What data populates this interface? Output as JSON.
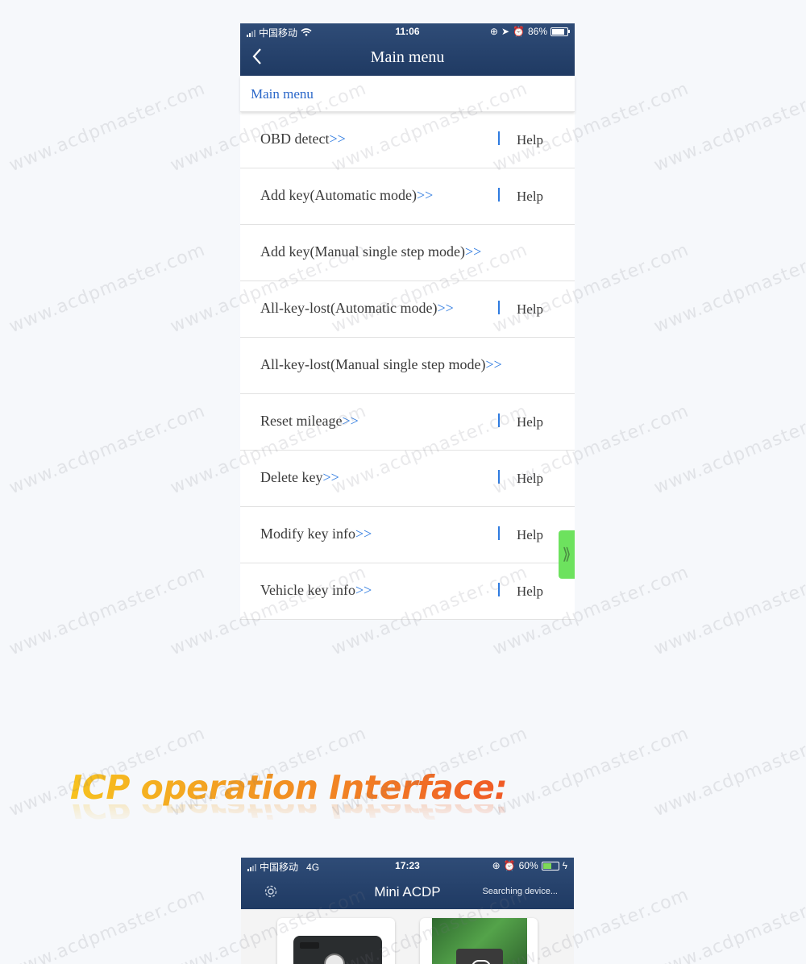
{
  "watermark": "www.acdpmaster.com",
  "phone1": {
    "status": {
      "carrier": "中国移动",
      "time": "11:06",
      "battery": "86%",
      "battery_level": 0.86
    },
    "title": "Main menu",
    "back_icon": "chevron-left-icon",
    "breadcrumb": "Main menu",
    "arrow_text": ">>",
    "help_label": "Help",
    "side_tab_glyph": "⟫",
    "items": [
      {
        "label": "OBD detect",
        "has_help": true
      },
      {
        "label": "Add key(Automatic mode)",
        "has_help": true
      },
      {
        "label": "Add key(Manual single step mode)",
        "has_help": false
      },
      {
        "label": "All-key-lost(Automatic mode)",
        "has_help": true
      },
      {
        "label": "All-key-lost(Manual single step mode)",
        "has_help": false
      },
      {
        "label": "Reset mileage",
        "has_help": true
      },
      {
        "label": "Delete key",
        "has_help": true
      },
      {
        "label": "Modify key info",
        "has_help": true
      },
      {
        "label": "Vehicle key info",
        "has_help": true
      }
    ]
  },
  "section_heading": "ICP operation Interface:",
  "phone2": {
    "status": {
      "carrier": "中国移动",
      "network": "4G",
      "time": "17:23",
      "battery": "60%",
      "battery_level": 0.6
    },
    "title": "Mini ACDP",
    "searching": "Searching device...",
    "settings_icon": "gear-icon"
  },
  "colors": {
    "nav_bg": "#243f69",
    "link_blue": "#2a67c9",
    "arrow_blue": "#2f7be0",
    "side_tab": "#6de25e"
  }
}
